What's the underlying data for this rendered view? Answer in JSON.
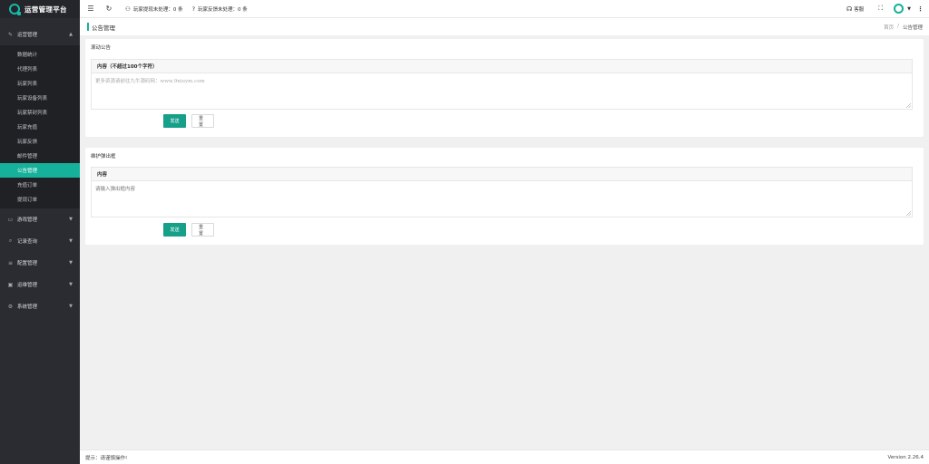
{
  "app": {
    "title": "运营管理平台"
  },
  "sidebar": {
    "groups": [
      {
        "label": "运营管理",
        "icon": "edit-icon",
        "expanded": true
      },
      {
        "label": "游戏管理",
        "icon": "gamepad-icon"
      },
      {
        "label": "记录查询",
        "icon": "search-icon"
      },
      {
        "label": "配置管理",
        "icon": "list-icon"
      },
      {
        "label": "运维管理",
        "icon": "monitor-icon"
      },
      {
        "label": "系统管理",
        "icon": "gear-icon"
      }
    ],
    "items": [
      {
        "label": "数据统计"
      },
      {
        "label": "代理列表"
      },
      {
        "label": "玩家列表"
      },
      {
        "label": "玩家设备列表"
      },
      {
        "label": "玩家禁封列表"
      },
      {
        "label": "玩家充值"
      },
      {
        "label": "玩家反馈"
      },
      {
        "label": "邮件管理"
      },
      {
        "label": "公告管理",
        "active": true
      },
      {
        "label": "充值订单"
      },
      {
        "label": "提现订单"
      }
    ]
  },
  "header": {
    "withdraw_pending": "玩家提现未处理：0 条",
    "feedback_pending": "玩家反馈未处理：0 条",
    "service_label": "客服"
  },
  "page": {
    "title": "公告管理",
    "breadcrumb": {
      "home": "首页",
      "sep": "/",
      "current": "公告管理"
    }
  },
  "scroll_notice": {
    "heading": "滚动公告",
    "field_label": "内容（不超过100个字符）",
    "content": "更多资源请前往九牛源码网：www.9niuym.com",
    "send_label": "发送",
    "reset_label": "重置"
  },
  "maintenance": {
    "heading": "维护弹出框",
    "field_label": "内容",
    "placeholder": "请输入弹出框内容",
    "send_label": "发送",
    "reset_label": "重置"
  },
  "footer": {
    "hint": "提示：请谨慎操作!",
    "version": "Version 2.26.4"
  },
  "colors": {
    "accent": "#16b19a",
    "sidebar_bg": "#2a2c31"
  }
}
